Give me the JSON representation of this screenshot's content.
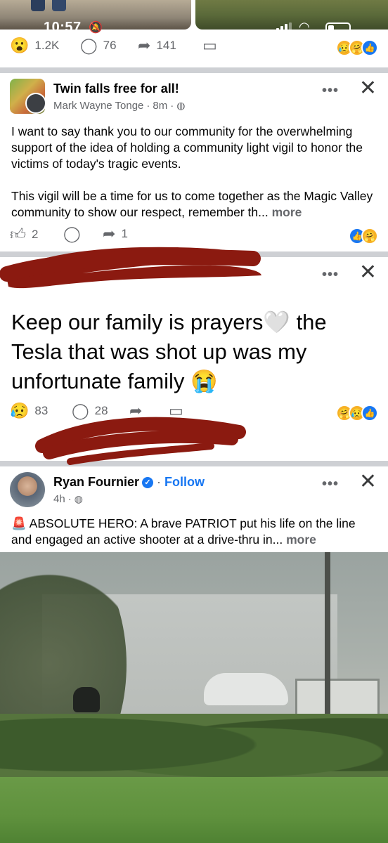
{
  "status_bar": {
    "time": "10:57"
  },
  "prev_post": {
    "reaction_count": "1.2K",
    "comment_count": "76",
    "share_count": "141"
  },
  "post1": {
    "group_name": "Twin falls free for all!",
    "author": "Mark Wayne Tonge",
    "time": "8m",
    "paragraph1": "I want to say thank you to our community for the overwhelming support of the idea of holding a community light vigil to honor the victims of today's tragic events.",
    "paragraph2": "This vigil will be a time for us to come together as the Magic Valley community to show our respect, remember th...",
    "more_label": "more",
    "reaction_count": "2",
    "share_count": "1"
  },
  "post2": {
    "text": "Keep our family is prayers🤍 the Tesla that was shot up was my unfortunate family 😭",
    "reaction_count": "83",
    "comment_count": "28"
  },
  "post3": {
    "author": "Ryan Fournier",
    "follow_label": "Follow",
    "time": "4h",
    "text": "🚨 ABSOLUTE HERO: A brave PATRIOT put his life on the line and engaged an active shooter at a drive-thru in...",
    "more_label": "more"
  },
  "colors": {
    "accent": "#1877f2",
    "secondary_text": "#65676b",
    "divider": "#ced0d4",
    "redaction": "#8b1a10"
  },
  "icons": [
    "wow-icon",
    "comment-icon",
    "share-icon",
    "save-icon",
    "like-icon",
    "more-icon",
    "close-icon",
    "globe-icon",
    "verified-icon"
  ]
}
